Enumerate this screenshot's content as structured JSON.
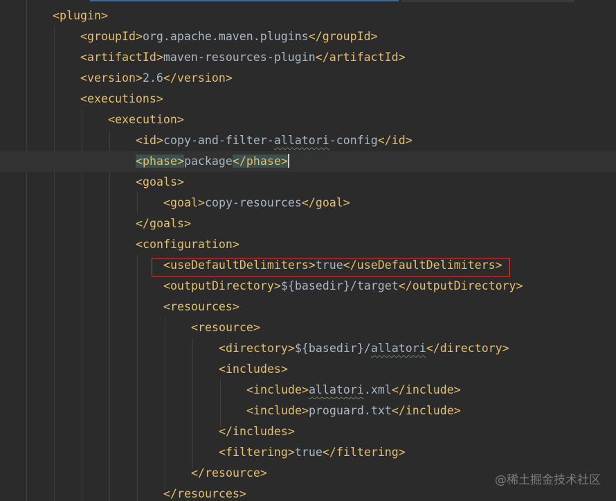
{
  "editor": {
    "lines": [
      {
        "open": "plugin",
        "text": "",
        "close": ""
      },
      {
        "open": "groupId",
        "text": "org.apache.maven.plugins",
        "close": "groupId"
      },
      {
        "open": "artifactId",
        "text": "maven-resources-plugin",
        "close": "artifactId"
      },
      {
        "open": "version",
        "text": "2.6",
        "close": "version"
      },
      {
        "open": "executions",
        "text": "",
        "close": ""
      },
      {
        "open": "execution",
        "text": "",
        "close": ""
      },
      {
        "open": "id",
        "text_pre": "copy-and-filter-",
        "text_squig": "allatori",
        "text_post": "-config",
        "close": "id"
      },
      {
        "open": "phase",
        "text": "package",
        "close": "phase"
      },
      {
        "open": "goals",
        "text": "",
        "close": ""
      },
      {
        "open": "goal",
        "text": "copy-resources",
        "close": "goal"
      },
      {
        "open": "",
        "text": "",
        "close": "goals"
      },
      {
        "open": "configuration",
        "text": "",
        "close": ""
      },
      {
        "open": "useDefaultDelimiters",
        "text": "true",
        "close": "useDefaultDelimiters"
      },
      {
        "open": "outputDirectory",
        "text": "${basedir}/target",
        "close": "outputDirectory"
      },
      {
        "open": "resources",
        "text": "",
        "close": ""
      },
      {
        "open": "resource",
        "text": "",
        "close": ""
      },
      {
        "open": "directory",
        "text_pre": "${basedir}/",
        "text_squig": "allatori",
        "text_post": "",
        "close": "directory"
      },
      {
        "open": "includes",
        "text": "",
        "close": ""
      },
      {
        "open": "include",
        "text_pre": "",
        "text_squig": "allatori",
        "text_post": ".xml",
        "close": "include"
      },
      {
        "open": "include",
        "text": "proguard.txt",
        "close": "include"
      },
      {
        "open": "",
        "text": "",
        "close": "includes"
      },
      {
        "open": "filtering",
        "text": "true",
        "close": "filtering"
      },
      {
        "open": "",
        "text": "",
        "close": "resource"
      },
      {
        "open": "",
        "text": "",
        "close": "resources"
      }
    ]
  },
  "watermark": "@稀土掘金技术社区",
  "colors": {
    "background": "#2b2b2b",
    "tag": "#e8bf6a",
    "text": "#a9b7c6",
    "highlight_border": "#e03a3a"
  }
}
